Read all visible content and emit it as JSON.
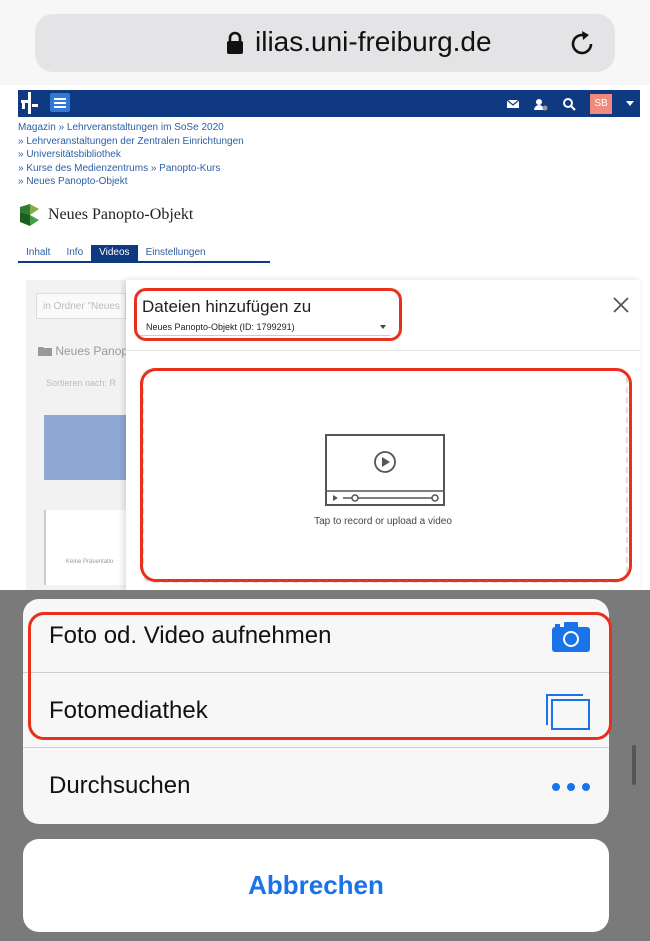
{
  "browser": {
    "url": "ilias.uni-freiburg.de"
  },
  "nav": {
    "avatar_initials": "SB"
  },
  "breadcrumb": [
    "Magazin  »  Lehrveranstaltungen im SoSe 2020",
    "»  Lehrveranstaltungen der Zentralen Einrichtungen",
    "»  Universitätsbibliothek",
    "»  Kurse des Medienzentrums  »  Panopto-Kurs",
    "»  Neues Panopto-Objekt"
  ],
  "object": {
    "title": "Neues Panopto-Objekt"
  },
  "tabs": [
    "Inhalt",
    "Info",
    "Videos",
    "Einstellungen"
  ],
  "background": {
    "search_placeholder": "in Ordner \"Neues",
    "folder_label": "Neues Panop",
    "sort_label": "Sortieren nach:  R",
    "card_caption": "Keine Präsentatio"
  },
  "modal": {
    "title": "Dateien hinzufügen zu",
    "select_value": "Neues Panopto-Objekt (ID: 1799291)",
    "upload_hint": "Tap to record or upload a video"
  },
  "action_sheet": {
    "items": [
      {
        "label": "Foto od. Video aufnehmen",
        "icon": "camera-icon"
      },
      {
        "label": "Fotomediathek",
        "icon": "photo-library-icon"
      },
      {
        "label": "Durchsuchen",
        "icon": "more-icon"
      }
    ],
    "cancel_label": "Abbrechen"
  },
  "colors": {
    "highlight": "#e8301d",
    "ios_blue": "#1a73e8",
    "nav_blue": "#0f3a82"
  }
}
